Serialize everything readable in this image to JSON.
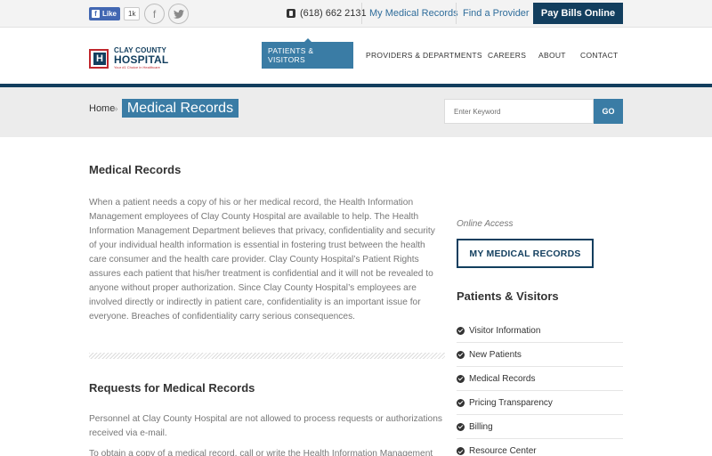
{
  "topbar": {
    "fb_like_label": "Like",
    "fb_like_count": "1k",
    "phone": "(618) 662 2131",
    "links": [
      "My Medical Records",
      "Find a Provider"
    ],
    "pay_button": "Pay Bills Online"
  },
  "header": {
    "logo_line1": "CLAY COUNTY",
    "logo_line2": "HOSPITAL",
    "logo_tagline": "Your #1 Choice in Healthcare",
    "nav": [
      "PATIENTS & VISITORS",
      "PROVIDERS & DEPARTMENTS",
      "CAREERS",
      "ABOUT",
      "CONTACT"
    ]
  },
  "banner": {
    "breadcrumb_home": "Home",
    "breadcrumb_sep": "»",
    "breadcrumb_current": "Medical Records",
    "search_placeholder": "Enter Keyword",
    "search_button": "GO"
  },
  "main": {
    "heading": "Medical Records",
    "paragraph1": "When a patient needs a copy of his or her medical record, the Health Information Management employees of Clay County Hospital are available to help. The Health Information Management Department believes that privacy, confidentiality and security of your individual health information is essential in fostering trust between the health care consumer and the health care provider. Clay County Hospital’s Patient Rights assures each patient that his/her treatment is confidential and it will not be revealed to anyone without proper authorization. Since Clay County Hospital’s employees are involved directly or indirectly in patient care, confidentiality is an important issue for everyone. Breaches of confidentiality carry serious consequences.",
    "subheading": "Requests for Medical Records",
    "paragraph2": "Personnel at Clay County Hospital are not allowed to process requests or authorizations received via e-mail.",
    "paragraph3": "To obtain a copy of a medical record, call or write the Health Information Management"
  },
  "sidebar": {
    "online_access": "Online Access",
    "my_records_button": "MY MEDICAL RECORDS",
    "heading": "Patients & Visitors",
    "items": [
      "Visitor Information",
      "New Patients",
      "Medical Records",
      "Pricing Transparency",
      "Billing",
      "Resource Center"
    ]
  },
  "colors": {
    "navy": "#123e5e",
    "accent_blue": "#3a7ca5",
    "brand_red": "#c0272d"
  }
}
